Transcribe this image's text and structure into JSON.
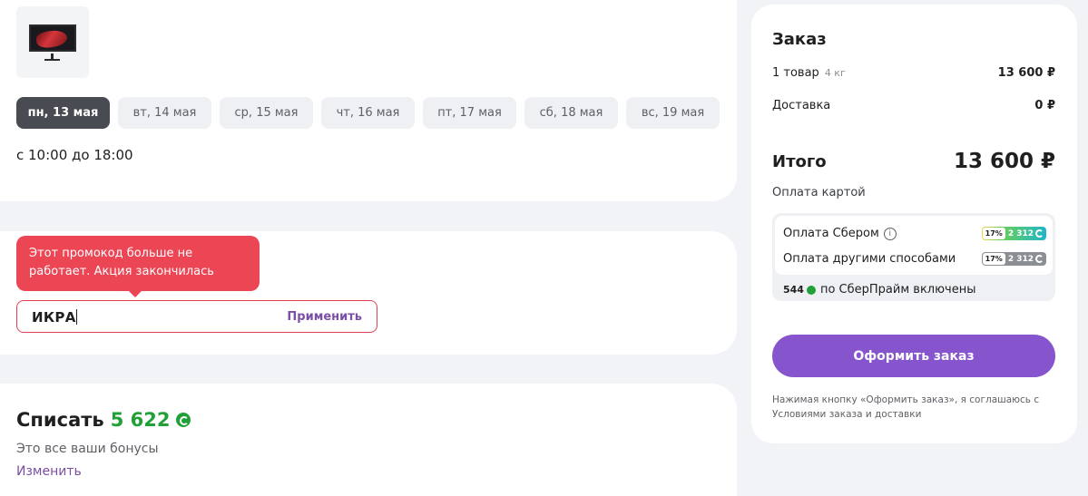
{
  "delivery": {
    "dates": [
      {
        "label": "пн, 13 мая",
        "active": true
      },
      {
        "label": "вт, 14 мая",
        "active": false
      },
      {
        "label": "ср, 15 мая",
        "active": false
      },
      {
        "label": "чт, 16 мая",
        "active": false
      },
      {
        "label": "пт, 17 мая",
        "active": false
      },
      {
        "label": "сб, 18 мая",
        "active": false
      },
      {
        "label": "вс, 19 мая",
        "active": false
      }
    ],
    "time_range": "с 10:00 до 18:00"
  },
  "promo": {
    "error_tooltip": "Этот промокод больше не работает. Акция закончилась",
    "value": "ИКРА",
    "apply_label": "Применить"
  },
  "bonus": {
    "title": "Списать",
    "amount": "5 622",
    "subtitle": "Это все ваши бонусы",
    "change_label": "Изменить"
  },
  "order": {
    "title": "Заказ",
    "items_label": "1 товар",
    "items_weight": "4 кг",
    "items_price": "13 600 ₽",
    "delivery_label": "Доставка",
    "delivery_price": "0 ₽",
    "total_label": "Итого",
    "total_value": "13 600 ₽",
    "payment_label": "Оплата картой",
    "pay_sber_label": "Оплата Сбером",
    "pay_sber_pct": "17%",
    "pay_sber_bonus": "2 312",
    "pay_other_label": "Оплата другими способами",
    "pay_other_pct": "17%",
    "pay_other_bonus": "2 312",
    "prime_amount": "544",
    "prime_text": "по СберПрайм включены",
    "checkout_label": "Оформить заказ",
    "legal_text": "Нажимая кнопку «Оформить заказ», я соглашаюсь с Условиями заказа и доставки"
  },
  "colors": {
    "accent_purple": "#8654cc",
    "error_red": "#ec4655",
    "bonus_green": "#21a038",
    "active_chip": "#484b51"
  }
}
